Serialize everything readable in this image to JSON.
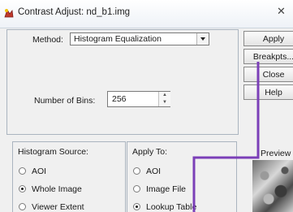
{
  "window": {
    "title": "Contrast Adjust: nd_b1.img",
    "close_glyph": "✕"
  },
  "method": {
    "label": "Method:",
    "selected": "Histogram Equalization"
  },
  "bins": {
    "label": "Number of Bins:",
    "value": "256"
  },
  "histogram_source": {
    "title": "Histogram Source:",
    "options": [
      {
        "label": "AOI",
        "selected": false
      },
      {
        "label": "Whole Image",
        "selected": true
      },
      {
        "label": "Viewer Extent",
        "selected": false
      }
    ]
  },
  "apply_to": {
    "title": "Apply To:",
    "options": [
      {
        "label": "AOI",
        "selected": false
      },
      {
        "label": "Image File",
        "selected": false
      },
      {
        "label": "Lookup Table",
        "selected": true
      }
    ]
  },
  "buttons": {
    "apply": "Apply",
    "breakpts": "Breakpts...",
    "close": "Close",
    "help": "Help"
  },
  "preview": {
    "label": "Preview"
  },
  "colors": {
    "annotation": "#7b3fb8"
  }
}
